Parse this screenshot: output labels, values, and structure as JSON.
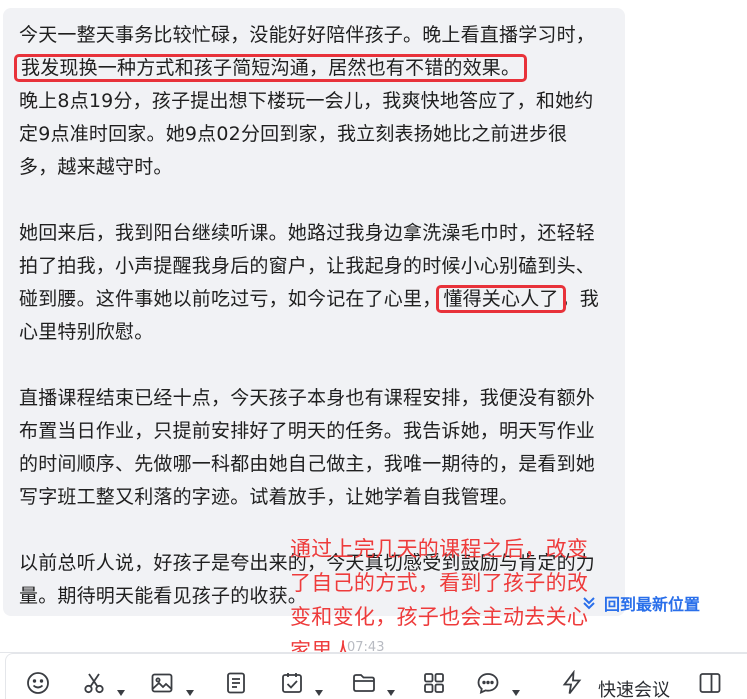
{
  "message": {
    "para1_lines": [
      "今天一整天事务比较忙碌，没能好好陪伴孩子。晚上看直播学习时，",
      "我发现换一种方式和孩子简短沟通，居然也有不错的效果。",
      "晚上8点19分，孩子提出想下楼玩一会儿，我爽快地答应了，和她约",
      "定9点准时回家。她9点02分回到家，我立刻表扬她比之前进步很",
      "多，越来越守时。"
    ],
    "para2_lines": [
      "她回来后，我到阳台继续听课。她路过我身边拿洗澡毛巾时，还轻轻",
      "拍了拍我，小声提醒我身后的窗户，让我起身的时候小心别磕到头、",
      "碰到腰。这件事她以前吃过亏，如今记在了心里，",
      "懂得关心人了",
      "，我",
      "心里特别欣慰。"
    ],
    "para3_lines": [
      "直播课程结束已经十点，今天孩子本身也有课程安排，我便没有额外",
      "布置当日作业，只提前安排好了明天的任务。我告诉她，明天写作业",
      "的时间顺序、先做哪一科都由她自己做主，我唯一期待的，是看到她",
      "写字班工整又利落的字迹。试着放手，让她学着自我管理。"
    ],
    "para4_lines": [
      "以前总听人说，好孩子是夸出来的，今天真切感受到鼓励与肯定的力",
      "量。期待明天能看见孩子的收获。"
    ],
    "time": "07:43"
  },
  "annotation": {
    "lines": [
      "通过上完几天的课程之后，改变",
      "了自己的方式，看到了孩子的改",
      "变和变化，孩子也会主动去关心",
      "家里人"
    ]
  },
  "back_to_latest": "回到最新位置",
  "toolbar": {
    "emoji_icon": "emoji-icon",
    "scissors_icon": "scissors-icon",
    "image_icon": "image-icon",
    "doc_icon": "document-icon",
    "todo_icon": "todo-icon",
    "folder_icon": "folder-icon",
    "apps_icon": "apps-icon",
    "chat_icon": "chat-icon",
    "quick_meeting_label": "快速会议"
  },
  "colors": {
    "highlight": "#e8323a",
    "annotation": "#ee3b3b",
    "link": "#2a6fea",
    "bubble": "#f1f2f5"
  }
}
